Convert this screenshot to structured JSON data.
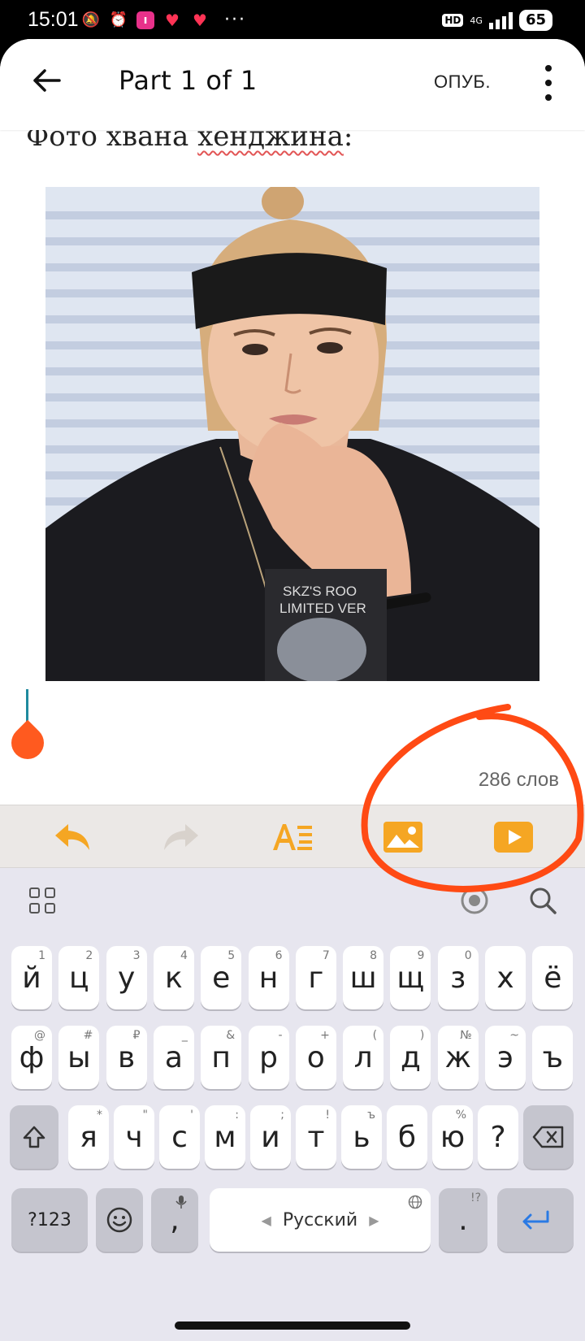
{
  "status_bar": {
    "time": "15:01",
    "network": "4G",
    "hd": "HD",
    "battery": "65",
    "more": "···"
  },
  "top_bar": {
    "title": "Part 1 of 1",
    "publish_label": "ОПУБ."
  },
  "document": {
    "line_prefix": "Фото хвана ",
    "line_misspelled": "хенджина",
    "line_suffix": ":",
    "photo_shirt_text_1": "SKZ'S ROO",
    "photo_shirt_text_2": "LIMITED VER"
  },
  "word_count": "286 слов",
  "toolbar": {
    "accent": "#f5a623",
    "disabled": "#d8d2cc",
    "items": [
      "undo-icon",
      "redo-icon",
      "text-format-icon",
      "insert-image-icon",
      "insert-video-icon"
    ]
  },
  "annotation_color": "#ff4a14",
  "keyboard": {
    "row1": [
      {
        "k": "й",
        "h": "1"
      },
      {
        "k": "ц",
        "h": "2"
      },
      {
        "k": "у",
        "h": "3"
      },
      {
        "k": "к",
        "h": "4"
      },
      {
        "k": "е",
        "h": "5"
      },
      {
        "k": "н",
        "h": "6"
      },
      {
        "k": "г",
        "h": "7"
      },
      {
        "k": "ш",
        "h": "8"
      },
      {
        "k": "щ",
        "h": "9"
      },
      {
        "k": "з",
        "h": "0"
      },
      {
        "k": "х",
        "h": ""
      },
      {
        "k": "ё",
        "h": ""
      }
    ],
    "row2": [
      {
        "k": "ф",
        "h": "@"
      },
      {
        "k": "ы",
        "h": "#"
      },
      {
        "k": "в",
        "h": "₽"
      },
      {
        "k": "а",
        "h": "_"
      },
      {
        "k": "п",
        "h": "&"
      },
      {
        "k": "р",
        "h": "-"
      },
      {
        "k": "о",
        "h": "+"
      },
      {
        "k": "л",
        "h": "("
      },
      {
        "k": "д",
        "h": ")"
      },
      {
        "k": "ж",
        "h": "№"
      },
      {
        "k": "э",
        "h": "~"
      },
      {
        "k": "ъ",
        "h": ""
      }
    ],
    "row3": [
      {
        "k": "я",
        "h": "*"
      },
      {
        "k": "ч",
        "h": "\""
      },
      {
        "k": "с",
        "h": "'"
      },
      {
        "k": "м",
        "h": ":"
      },
      {
        "k": "и",
        "h": ";"
      },
      {
        "k": "т",
        "h": "!"
      },
      {
        "k": "ь",
        "h": "ъ"
      },
      {
        "k": "б",
        "h": ""
      },
      {
        "k": "ю",
        "h": "%"
      },
      {
        "k": "?",
        "h": ""
      }
    ],
    "symbols_label": "?123",
    "comma": ",",
    "space_label": "Русский",
    "period": ".",
    "period_hint": "!?"
  }
}
